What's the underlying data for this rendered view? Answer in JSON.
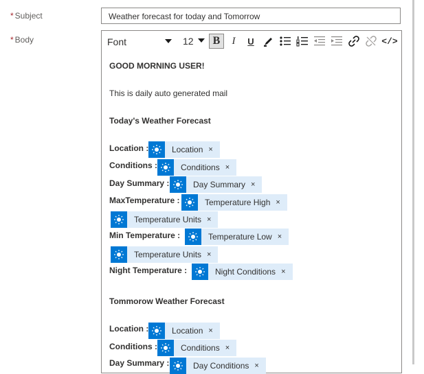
{
  "subject": {
    "label": "Subject",
    "value": "Weather forecast for today and Tomorrow"
  },
  "body": {
    "label": "Body"
  },
  "required_mark": "*",
  "toolbar": {
    "font_label": "Font",
    "size_value": "12",
    "bold": "B",
    "italic": "I",
    "underline": "U",
    "code_glyph": "</>"
  },
  "content": {
    "greeting": "GOOD MORNING USER!",
    "intro": "This is daily auto generated mail",
    "today_heading": "Today's Weather Forecast",
    "today": {
      "location_label": "Location :",
      "conditions_label": "Conditions :",
      "day_summary_label": "Day Summary :",
      "max_temp_label": "MaxTemperature :",
      "min_temp_label": "Min Temperature :",
      "night_temp_label": "Night Temperature :",
      "tokens": {
        "location": "Location",
        "conditions": "Conditions",
        "day_summary": "Day Summary",
        "temp_high": "Temperature High",
        "temp_units_1": "Temperature Units",
        "temp_low": "Temperature Low",
        "temp_units_2": "Temperature Units",
        "night_conditions": "Night Conditions"
      }
    },
    "tomorrow_heading": "Tommorow Weather Forecast",
    "tomorrow": {
      "location_label": "Location :",
      "conditions_label": "Conditions :",
      "day_summary_label": "Day Summary :",
      "tokens": {
        "location": "Location",
        "conditions": "Conditions",
        "day_conditions": "Day Conditions"
      }
    },
    "remove_glyph": "×"
  },
  "colors": {
    "token_bg": "#deecf9",
    "token_icon_bg": "#0078d4",
    "required": "#a4262c"
  },
  "icons": {
    "token": "sun-icon"
  }
}
